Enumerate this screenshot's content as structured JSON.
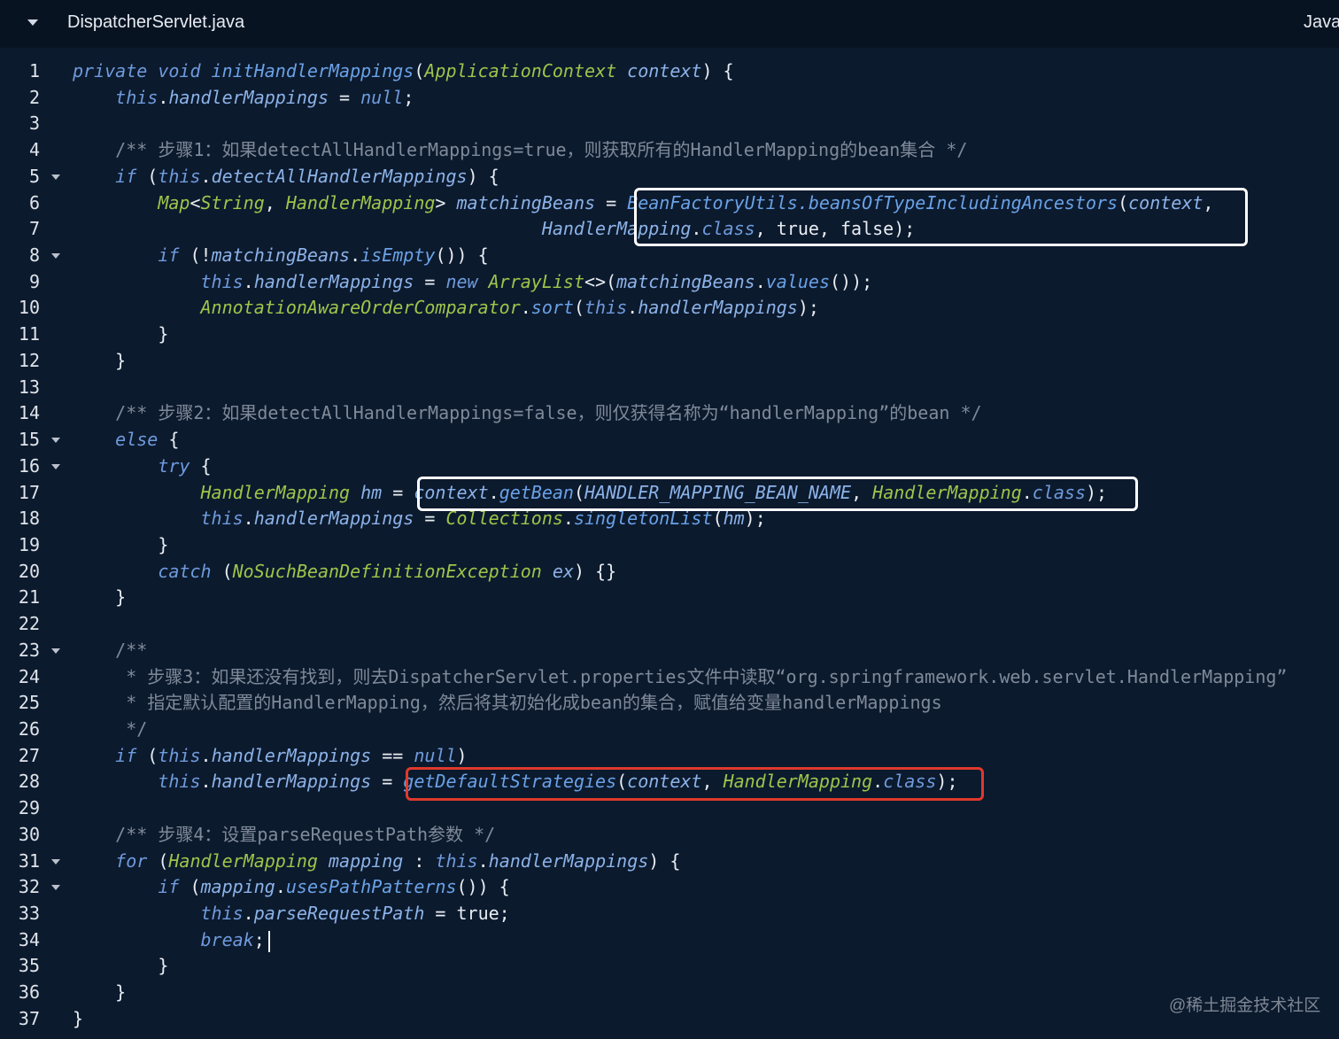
{
  "editor": {
    "file_name": "DispatcherServlet.java",
    "language": "Java",
    "collapse_icon": "chevron-down-icon",
    "watermark": "@稀土掘金技术社区"
  },
  "code_lines": [
    {
      "n": "1",
      "fold": false,
      "tokens": [
        [
          "kw",
          "private void "
        ],
        [
          "fn",
          "initHandlerMappings"
        ],
        [
          "pn",
          "("
        ],
        [
          "ty",
          "ApplicationContext "
        ],
        [
          "id",
          "context"
        ],
        [
          "pn",
          ") {"
        ]
      ]
    },
    {
      "n": "2",
      "fold": false,
      "tokens": [
        [
          "pn",
          "    "
        ],
        [
          "kw",
          "this"
        ],
        [
          "pn",
          "."
        ],
        [
          "id",
          "handlerMappings"
        ],
        [
          "pn",
          " = "
        ],
        [
          "kw",
          "null"
        ],
        [
          "pn",
          ";"
        ]
      ]
    },
    {
      "n": "3",
      "fold": false,
      "tokens": []
    },
    {
      "n": "4",
      "fold": false,
      "tokens": [
        [
          "co",
          "    /** 步骤1：如果detectAllHandlerMappings=true，则获取所有的HandlerMapping的bean集合 */"
        ]
      ]
    },
    {
      "n": "5",
      "fold": true,
      "tokens": [
        [
          "pn",
          "    "
        ],
        [
          "kw",
          "if"
        ],
        [
          "pn",
          " ("
        ],
        [
          "kw",
          "this"
        ],
        [
          "pn",
          "."
        ],
        [
          "id",
          "detectAllHandlerMappings"
        ],
        [
          "pn",
          ") {"
        ]
      ]
    },
    {
      "n": "6",
      "fold": false,
      "tokens": [
        [
          "pn",
          "        "
        ],
        [
          "ty",
          "Map"
        ],
        [
          "pn",
          "<"
        ],
        [
          "ty",
          "String"
        ],
        [
          "pn",
          ", "
        ],
        [
          "ty",
          "HandlerMapping"
        ],
        [
          "pn",
          "> "
        ],
        [
          "id",
          "matchingBeans"
        ],
        [
          "pn",
          " = "
        ],
        [
          "fn",
          "BeanFactoryUtils.beansOfTypeIncludingAncestors"
        ],
        [
          "pn",
          "("
        ],
        [
          "id",
          "context"
        ],
        [
          "pn",
          ","
        ]
      ]
    },
    {
      "n": "7",
      "fold": false,
      "tokens": [
        [
          "pn",
          "                                            "
        ],
        [
          "id",
          "HandlerMapping"
        ],
        [
          "pn",
          "."
        ],
        [
          "kw",
          "class"
        ],
        [
          "pn",
          ", true, false);"
        ]
      ]
    },
    {
      "n": "8",
      "fold": true,
      "tokens": [
        [
          "pn",
          "        "
        ],
        [
          "kw",
          "if"
        ],
        [
          "pn",
          " (!"
        ],
        [
          "id",
          "matchingBeans"
        ],
        [
          "pn",
          "."
        ],
        [
          "fn",
          "isEmpty"
        ],
        [
          "pn",
          "()) {"
        ]
      ]
    },
    {
      "n": "9",
      "fold": false,
      "tokens": [
        [
          "pn",
          "            "
        ],
        [
          "kw",
          "this"
        ],
        [
          "pn",
          "."
        ],
        [
          "id",
          "handlerMappings"
        ],
        [
          "pn",
          " = "
        ],
        [
          "kw",
          "new "
        ],
        [
          "ty",
          "ArrayList"
        ],
        [
          "pn",
          "<>("
        ],
        [
          "id",
          "matchingBeans"
        ],
        [
          "pn",
          "."
        ],
        [
          "fn",
          "values"
        ],
        [
          "pn",
          "());"
        ]
      ]
    },
    {
      "n": "10",
      "fold": false,
      "tokens": [
        [
          "pn",
          "            "
        ],
        [
          "ty",
          "AnnotationAwareOrderComparator"
        ],
        [
          "pn",
          "."
        ],
        [
          "fn",
          "sort"
        ],
        [
          "pn",
          "("
        ],
        [
          "kw",
          "this"
        ],
        [
          "pn",
          "."
        ],
        [
          "id",
          "handlerMappings"
        ],
        [
          "pn",
          ");"
        ]
      ]
    },
    {
      "n": "11",
      "fold": false,
      "tokens": [
        [
          "pn",
          "        }"
        ]
      ]
    },
    {
      "n": "12",
      "fold": false,
      "tokens": [
        [
          "pn",
          "    }"
        ]
      ]
    },
    {
      "n": "13",
      "fold": false,
      "tokens": []
    },
    {
      "n": "14",
      "fold": false,
      "tokens": [
        [
          "co",
          "    /** 步骤2：如果detectAllHandlerMappings=false，则仅获得名称为“handlerMapping”的bean */"
        ]
      ]
    },
    {
      "n": "15",
      "fold": true,
      "tokens": [
        [
          "pn",
          "    "
        ],
        [
          "kw",
          "else"
        ],
        [
          "pn",
          " {"
        ]
      ]
    },
    {
      "n": "16",
      "fold": true,
      "tokens": [
        [
          "pn",
          "        "
        ],
        [
          "kw",
          "try"
        ],
        [
          "pn",
          " {"
        ]
      ]
    },
    {
      "n": "17",
      "fold": false,
      "tokens": [
        [
          "pn",
          "            "
        ],
        [
          "ty",
          "HandlerMapping "
        ],
        [
          "id",
          "hm"
        ],
        [
          "pn",
          " = "
        ],
        [
          "id",
          "context"
        ],
        [
          "pn",
          "."
        ],
        [
          "fn",
          "getBean"
        ],
        [
          "pn",
          "("
        ],
        [
          "id",
          "HANDLER_MAPPING_BEAN_NAME"
        ],
        [
          "pn",
          ", "
        ],
        [
          "ty",
          "HandlerMapping"
        ],
        [
          "pn",
          "."
        ],
        [
          "kw",
          "class"
        ],
        [
          "pn",
          ");"
        ]
      ]
    },
    {
      "n": "18",
      "fold": false,
      "tokens": [
        [
          "pn",
          "            "
        ],
        [
          "kw",
          "this"
        ],
        [
          "pn",
          "."
        ],
        [
          "id",
          "handlerMappings"
        ],
        [
          "pn",
          " = "
        ],
        [
          "ty",
          "Collections"
        ],
        [
          "pn",
          "."
        ],
        [
          "fn",
          "singletonList"
        ],
        [
          "pn",
          "("
        ],
        [
          "id",
          "hm"
        ],
        [
          "pn",
          ");"
        ]
      ]
    },
    {
      "n": "19",
      "fold": false,
      "tokens": [
        [
          "pn",
          "        }"
        ]
      ]
    },
    {
      "n": "20",
      "fold": false,
      "tokens": [
        [
          "pn",
          "        "
        ],
        [
          "kw",
          "catch"
        ],
        [
          "pn",
          " ("
        ],
        [
          "ty",
          "NoSuchBeanDefinitionException "
        ],
        [
          "id",
          "ex"
        ],
        [
          "pn",
          ") {}"
        ]
      ]
    },
    {
      "n": "21",
      "fold": false,
      "tokens": [
        [
          "pn",
          "    }"
        ]
      ]
    },
    {
      "n": "22",
      "fold": false,
      "tokens": []
    },
    {
      "n": "23",
      "fold": true,
      "tokens": [
        [
          "co",
          "    /**"
        ]
      ]
    },
    {
      "n": "24",
      "fold": false,
      "tokens": [
        [
          "co",
          "     * 步骤3：如果还没有找到，则去DispatcherServlet.properties文件中读取“org.springframework.web.servlet.HandlerMapping”"
        ]
      ]
    },
    {
      "n": "25",
      "fold": false,
      "tokens": [
        [
          "co",
          "     * 指定默认配置的HandlerMapping，然后将其初始化成bean的集合，赋值给变量handlerMappings"
        ]
      ]
    },
    {
      "n": "26",
      "fold": false,
      "tokens": [
        [
          "co",
          "     */"
        ]
      ]
    },
    {
      "n": "27",
      "fold": false,
      "tokens": [
        [
          "pn",
          "    "
        ],
        [
          "kw",
          "if"
        ],
        [
          "pn",
          " ("
        ],
        [
          "kw",
          "this"
        ],
        [
          "pn",
          "."
        ],
        [
          "id",
          "handlerMappings"
        ],
        [
          "pn",
          " == "
        ],
        [
          "kw",
          "null"
        ],
        [
          "pn",
          ")"
        ]
      ]
    },
    {
      "n": "28",
      "fold": false,
      "tokens": [
        [
          "pn",
          "        "
        ],
        [
          "kw",
          "this"
        ],
        [
          "pn",
          "."
        ],
        [
          "id",
          "handlerMappings"
        ],
        [
          "pn",
          " = "
        ],
        [
          "fn",
          "getDefaultStrategies"
        ],
        [
          "pn",
          "("
        ],
        [
          "id",
          "context"
        ],
        [
          "pn",
          ", "
        ],
        [
          "ty",
          "HandlerMapping"
        ],
        [
          "pn",
          "."
        ],
        [
          "kw",
          "class"
        ],
        [
          "pn",
          ");"
        ]
      ]
    },
    {
      "n": "29",
      "fold": false,
      "tokens": []
    },
    {
      "n": "30",
      "fold": false,
      "tokens": [
        [
          "co",
          "    /** 步骤4：设置parseRequestPath参数 */"
        ]
      ]
    },
    {
      "n": "31",
      "fold": true,
      "tokens": [
        [
          "pn",
          "    "
        ],
        [
          "kw",
          "for"
        ],
        [
          "pn",
          " ("
        ],
        [
          "ty",
          "HandlerMapping "
        ],
        [
          "id",
          "mapping"
        ],
        [
          "pn",
          " : "
        ],
        [
          "kw",
          "this"
        ],
        [
          "pn",
          "."
        ],
        [
          "id",
          "handlerMappings"
        ],
        [
          "pn",
          ") {"
        ]
      ]
    },
    {
      "n": "32",
      "fold": true,
      "tokens": [
        [
          "pn",
          "        "
        ],
        [
          "kw",
          "if"
        ],
        [
          "pn",
          " ("
        ],
        [
          "id",
          "mapping"
        ],
        [
          "pn",
          "."
        ],
        [
          "fn",
          "usesPathPatterns"
        ],
        [
          "pn",
          "()) {"
        ]
      ]
    },
    {
      "n": "33",
      "fold": false,
      "tokens": [
        [
          "pn",
          "            "
        ],
        [
          "kw",
          "this"
        ],
        [
          "pn",
          "."
        ],
        [
          "id",
          "parseRequestPath"
        ],
        [
          "pn",
          " = true;"
        ]
      ]
    },
    {
      "n": "34",
      "fold": false,
      "tokens": [
        [
          "pn",
          "            "
        ],
        [
          "kw",
          "break"
        ],
        [
          "pn",
          ";"
        ]
      ]
    },
    {
      "n": "35",
      "fold": false,
      "tokens": [
        [
          "pn",
          "        }"
        ]
      ]
    },
    {
      "n": "36",
      "fold": false,
      "tokens": [
        [
          "pn",
          "    }"
        ]
      ]
    },
    {
      "n": "37",
      "fold": false,
      "tokens": [
        [
          "pn",
          "}"
        ]
      ]
    }
  ],
  "highlights": [
    {
      "color": "white",
      "lines": "6-7"
    },
    {
      "color": "white",
      "lines": "17"
    },
    {
      "color": "red",
      "lines": "28"
    }
  ]
}
